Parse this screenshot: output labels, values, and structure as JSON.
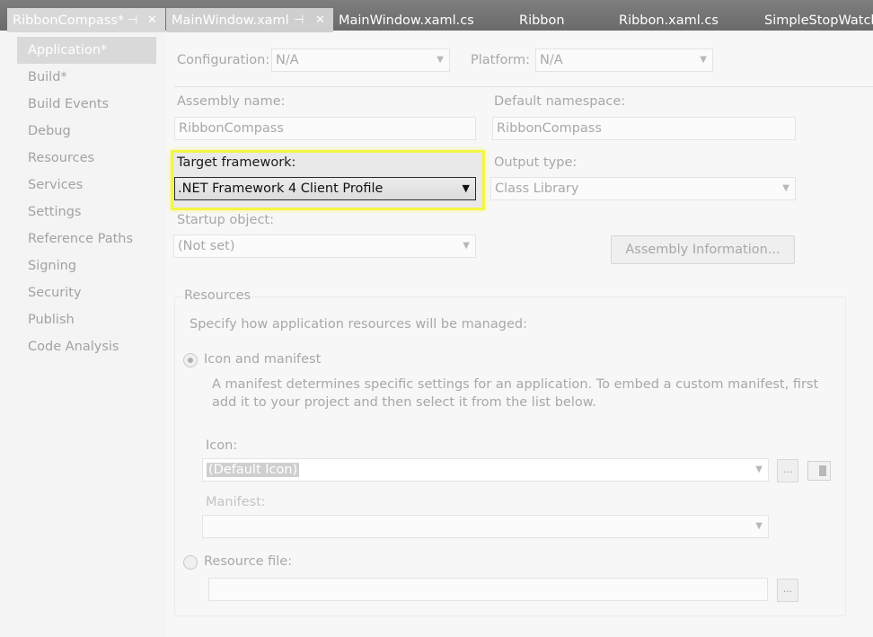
{
  "tabs": [
    {
      "label": "RibbonCompass*",
      "pin": "⊣",
      "close": "✕"
    },
    {
      "label": "MainWindow.xaml",
      "pin": "⊣",
      "close": "✕"
    },
    {
      "label": "MainWindow.xaml.cs"
    },
    {
      "label": "Ribbon"
    },
    {
      "label": "Ribbon.xaml.cs"
    },
    {
      "label": "SimpleStopWatch."
    }
  ],
  "sidebar": {
    "items": [
      {
        "label": "Application*"
      },
      {
        "label": "Build*"
      },
      {
        "label": "Build Events"
      },
      {
        "label": "Debug"
      },
      {
        "label": "Resources"
      },
      {
        "label": "Services"
      },
      {
        "label": "Settings"
      },
      {
        "label": "Reference Paths"
      },
      {
        "label": "Signing"
      },
      {
        "label": "Security"
      },
      {
        "label": "Publish"
      },
      {
        "label": "Code Analysis"
      }
    ]
  },
  "config": {
    "configuration_label": "Configuration:",
    "configuration_value": "N/A",
    "platform_label": "Platform:",
    "platform_value": "N/A"
  },
  "application": {
    "assembly_name_label": "Assembly name:",
    "assembly_name_value": "RibbonCompass",
    "default_namespace_label": "Default namespace:",
    "default_namespace_value": "RibbonCompass",
    "target_framework_label": "Target framework:",
    "target_framework_value": ".NET Framework 4 Client Profile",
    "output_type_label": "Output type:",
    "output_type_value": "Class Library",
    "startup_object_label": "Startup object:",
    "startup_object_value": "(Not set)",
    "assembly_info_button": "Assembly Information..."
  },
  "resources": {
    "group_label": "Resources",
    "description": "Specify how application resources will be managed:",
    "icon_manifest_label": "Icon and manifest",
    "icon_manifest_desc_1": "A manifest determines specific settings for an application. To embed a custom manifest, first",
    "icon_manifest_desc_2": "add it to your project and then select it from the list below.",
    "icon_label": "Icon:",
    "icon_value": "(Default Icon)",
    "browse_label": "...",
    "manifest_label": "Manifest:",
    "resource_file_label": "Resource file:"
  },
  "icons": {
    "dropdown": "▼",
    "pin": "pin-icon",
    "close": "close-icon"
  },
  "colors": {
    "highlight_border": "#f4f444"
  }
}
